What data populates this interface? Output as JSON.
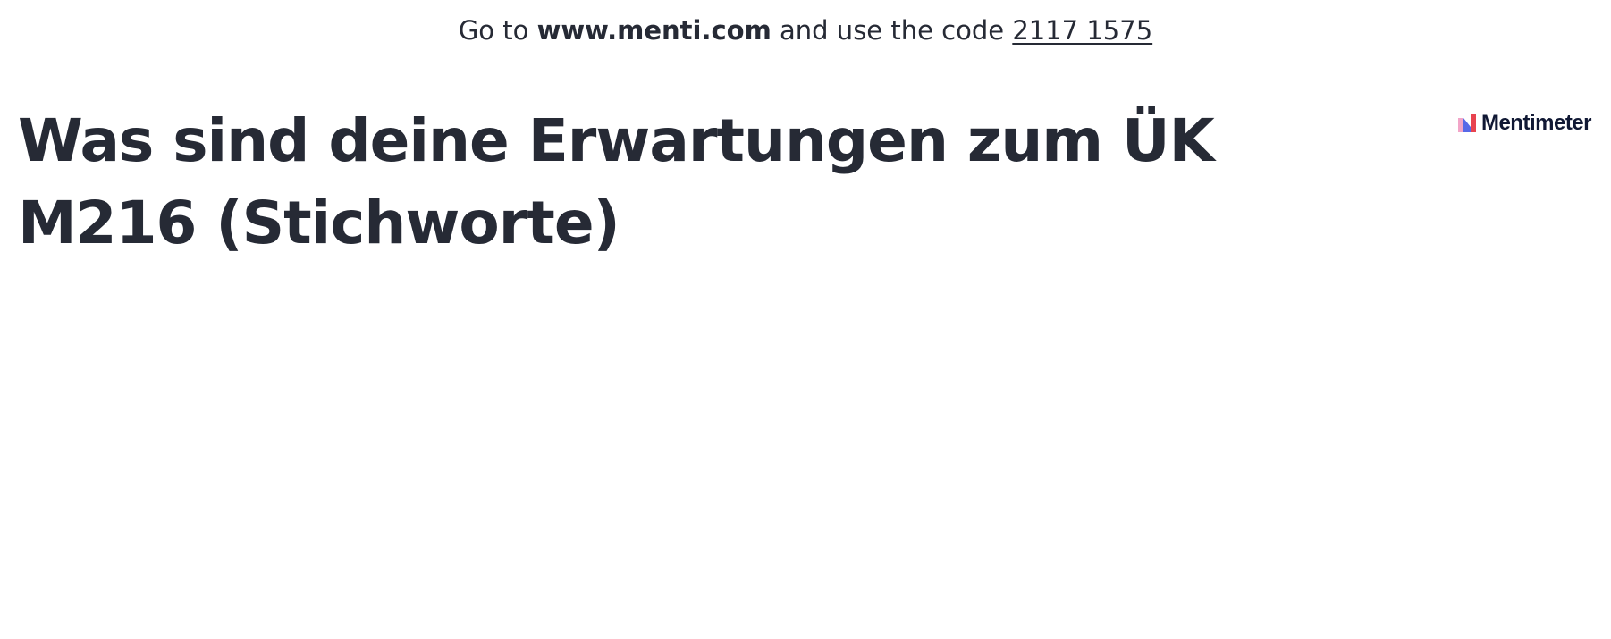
{
  "join": {
    "prefix": "Go to ",
    "url": "www.menti.com",
    "middle": " and use the code ",
    "code": "2117 1575"
  },
  "question": {
    "title": "Was sind deine Erwartungen zum ÜK M216 (Stichworte)"
  },
  "brand": {
    "name": "Mentimeter",
    "logo_icon": "mentimeter-logo-icon",
    "colors": {
      "pink": "#f2a5c8",
      "blue": "#5769e7",
      "red": "#e8434f"
    }
  },
  "colors": {
    "text": "#262a35",
    "background": "#ffffff"
  }
}
